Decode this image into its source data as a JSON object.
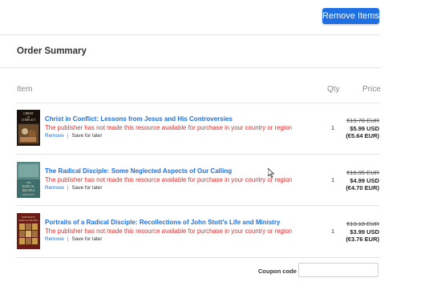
{
  "toolbar": {
    "remove_items_label": "Remove Items"
  },
  "summary": {
    "title": "Order Summary",
    "columns": {
      "item": "Item",
      "qty": "Qty",
      "price": "Price"
    }
  },
  "items": [
    {
      "title": "Christ in Conflict: Lessons from Jesus and His Controversies",
      "notice": "The publisher has not made this resource available for purchase in your country or region",
      "remove": "Remove",
      "save": "Save for later",
      "qty": "1",
      "price_old": "€19.78 EUR",
      "price_usd": "$5.99 USD",
      "price_eur": "(€5.64 EUR)",
      "cover_colors": [
        "#2a1c14",
        "#c9b48a"
      ]
    },
    {
      "title": "The Radical Disciple: Some Neglected Aspects of Our Calling",
      "notice": "The publisher has not made this resource available for purchase in your country or region",
      "remove": "Remove",
      "save": "Save for later",
      "qty": "1",
      "price_old": "€16.95 EUR",
      "price_usd": "$4.99 USD",
      "price_eur": "(€4.70 EUR)",
      "cover_colors": [
        "#3d6e6c",
        "#d9d0b0"
      ]
    },
    {
      "title": "Portraits of a Radical Disciple: Recollections of John Stott's Life and Ministry",
      "notice": "The publisher has not made this resource available for purchase in your country or region",
      "remove": "Remove",
      "save": "Save for later",
      "qty": "1",
      "price_old": "€13.18 EUR",
      "price_usd": "$3.99 USD",
      "price_eur": "(€3.76 EUR)",
      "cover_colors": [
        "#6b1c18",
        "#c89a4a"
      ]
    }
  ],
  "coupon": {
    "label": "Coupon code",
    "value": ""
  }
}
